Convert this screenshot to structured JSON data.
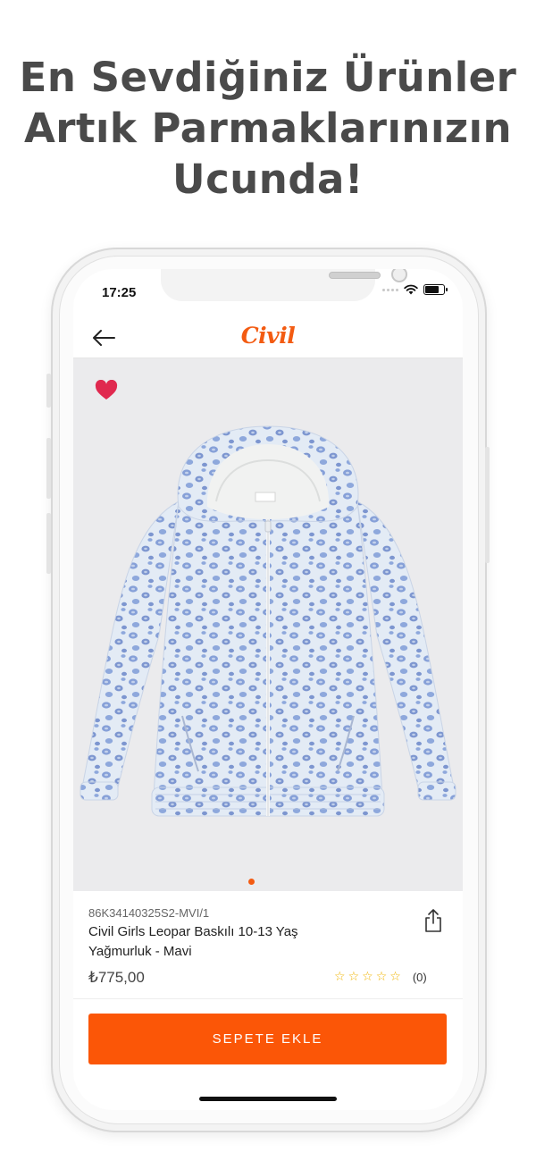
{
  "promo": {
    "headline_lines": [
      "En Sevdiğiniz Ürünler",
      "Artık Parmaklarınızın",
      "Ucunda!"
    ]
  },
  "status_bar": {
    "time": "17:25"
  },
  "header": {
    "brand": "Civil"
  },
  "product": {
    "sku": "86K34140325S2-MVI/1",
    "name": "Civil Girls Leopar Baskılı 10-13 Yaş Yağmurluk - Mavi",
    "price": "₺775,00",
    "rating_stars": 0,
    "rating_max": 5,
    "review_count": "(0)",
    "gallery_count": 1,
    "gallery_active": 1
  },
  "actions": {
    "add_to_cart": "SEPETE EKLE"
  },
  "icons": {
    "back": "arrow-left-icon",
    "favorite": "heart-icon",
    "share": "share-icon",
    "wifi": "wifi-icon",
    "battery": "battery-icon"
  },
  "colors": {
    "brand": "#f35b12",
    "button": "#fb5607",
    "favorite": "#e0294f",
    "gallery_bg": "#ebebed",
    "star": "#f0b400"
  }
}
